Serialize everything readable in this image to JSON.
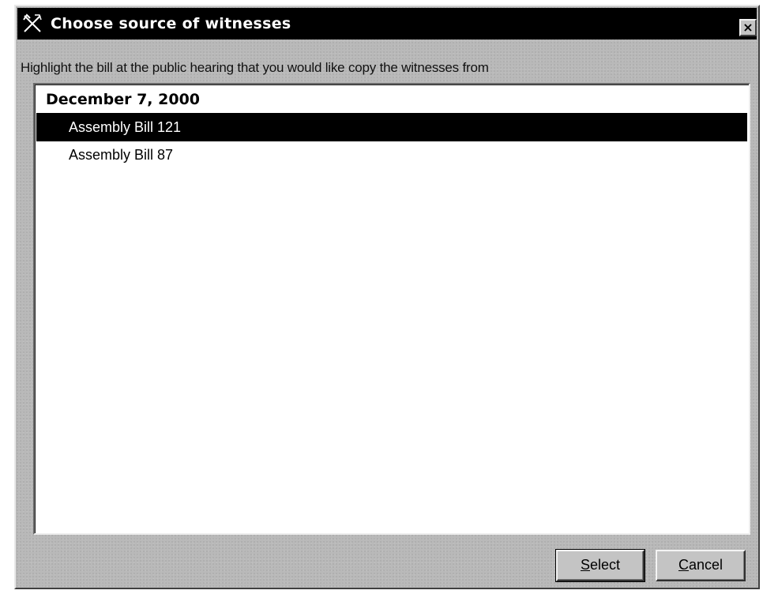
{
  "window": {
    "title": "Choose source of witnesses",
    "icon": "crossed-tools-icon",
    "close_glyph": "×"
  },
  "instruction": "Highlight the bill at the public hearing that you would like copy the witnesses from",
  "list": {
    "group_header": "December 7, 2000",
    "items": [
      {
        "label": "Assembly Bill 121",
        "selected": true
      },
      {
        "label": "Assembly Bill 87",
        "selected": false
      }
    ]
  },
  "buttons": {
    "select": {
      "mnemonic": "S",
      "rest": "elect"
    },
    "cancel": {
      "mnemonic": "C",
      "rest": "ancel"
    }
  },
  "colors": {
    "titlebar": "#000000",
    "dialog_face": "#b9b9b9",
    "selection": "#000000",
    "list_bg": "#ffffff"
  }
}
